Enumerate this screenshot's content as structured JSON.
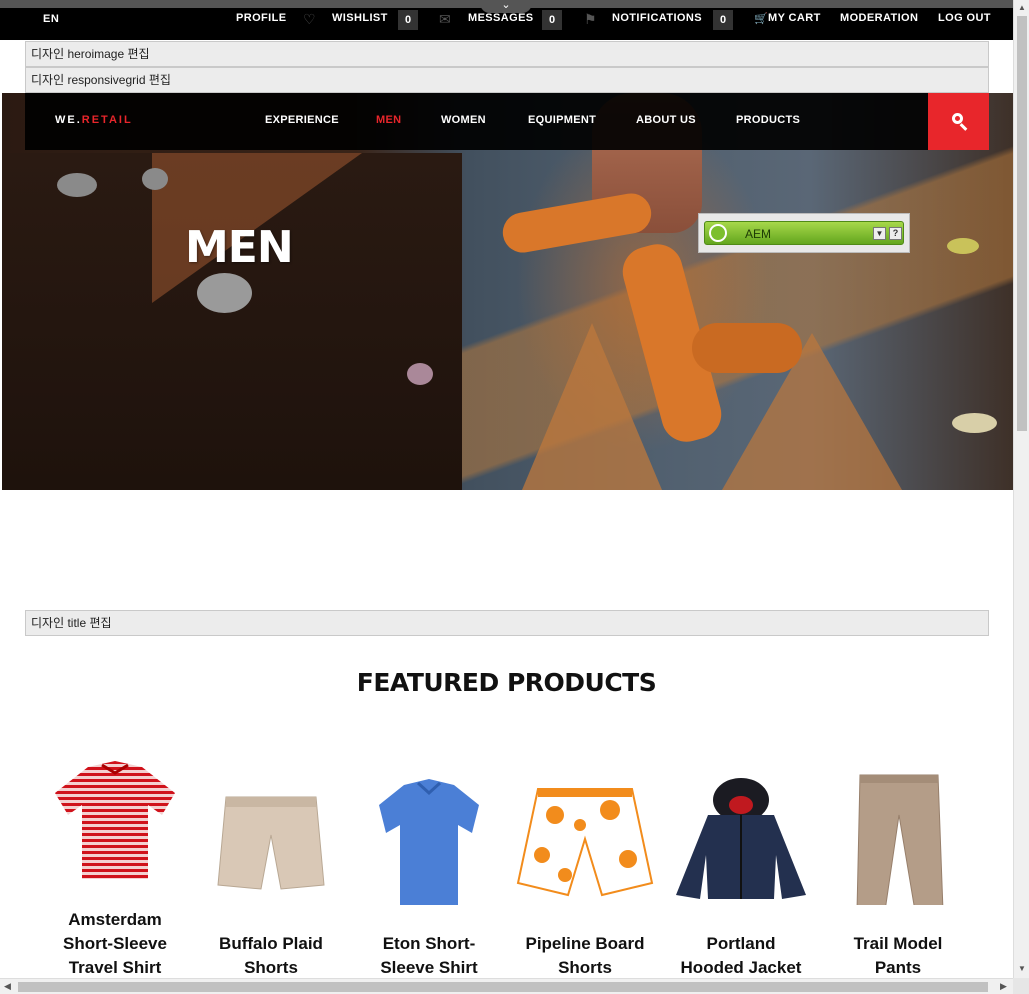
{
  "topbar": {
    "language": "EN",
    "profile": "PROFILE",
    "wishlist": "WISHLIST",
    "wishlist_count": "0",
    "messages": "MESSAGES",
    "messages_count": "0",
    "notifications": "NOTIFICATIONS",
    "notifications_count": "0",
    "cart": "MY CART",
    "moderation": "MODERATION",
    "logout": "LOG OUT"
  },
  "editbars": {
    "heroimage": "디자인 heroimage 편집",
    "responsivegrid": "디자인 responsivegrid 편집",
    "title": "디자인 title 편집"
  },
  "brand": {
    "prefix": "WE.",
    "suffix": "RETAIL"
  },
  "nav": [
    "EXPERIENCE",
    "MEN",
    "WOMEN",
    "EQUIPMENT",
    "ABOUT US",
    "PRODUCTS"
  ],
  "hero": {
    "title": "MEN"
  },
  "aem_widget": {
    "label": "AEM",
    "help": "?"
  },
  "featured": {
    "title": "FEATURED PRODUCTS",
    "products": [
      {
        "name": "Amsterdam Short-Sleeve Travel Shirt",
        "line1": "Amsterdam",
        "line2": "Short-Sleeve",
        "line3": "Travel Shirt"
      },
      {
        "name": "Buffalo Plaid Shorts",
        "line1": "Buffalo Plaid",
        "line2": "Shorts"
      },
      {
        "name": "Eton Short-Sleeve Shirt",
        "line1": "Eton Short-",
        "line2": "Sleeve Shirt"
      },
      {
        "name": "Pipeline Board Shorts",
        "line1": "Pipeline Board",
        "line2": "Shorts"
      },
      {
        "name": "Portland Hooded Jacket",
        "line1": "Portland",
        "line2": "Hooded Jacket"
      },
      {
        "name": "Trail Model Pants",
        "line1": "Trail Model",
        "line2": "Pants"
      }
    ]
  },
  "colors": {
    "accent": "#e8262b",
    "bar": "#000000",
    "aem_green": "#7cbf2d"
  },
  "icons": [
    "heart-icon",
    "envelope-icon",
    "flag-icon",
    "cart-icon",
    "search-icon",
    "chevron-down-icon"
  ]
}
